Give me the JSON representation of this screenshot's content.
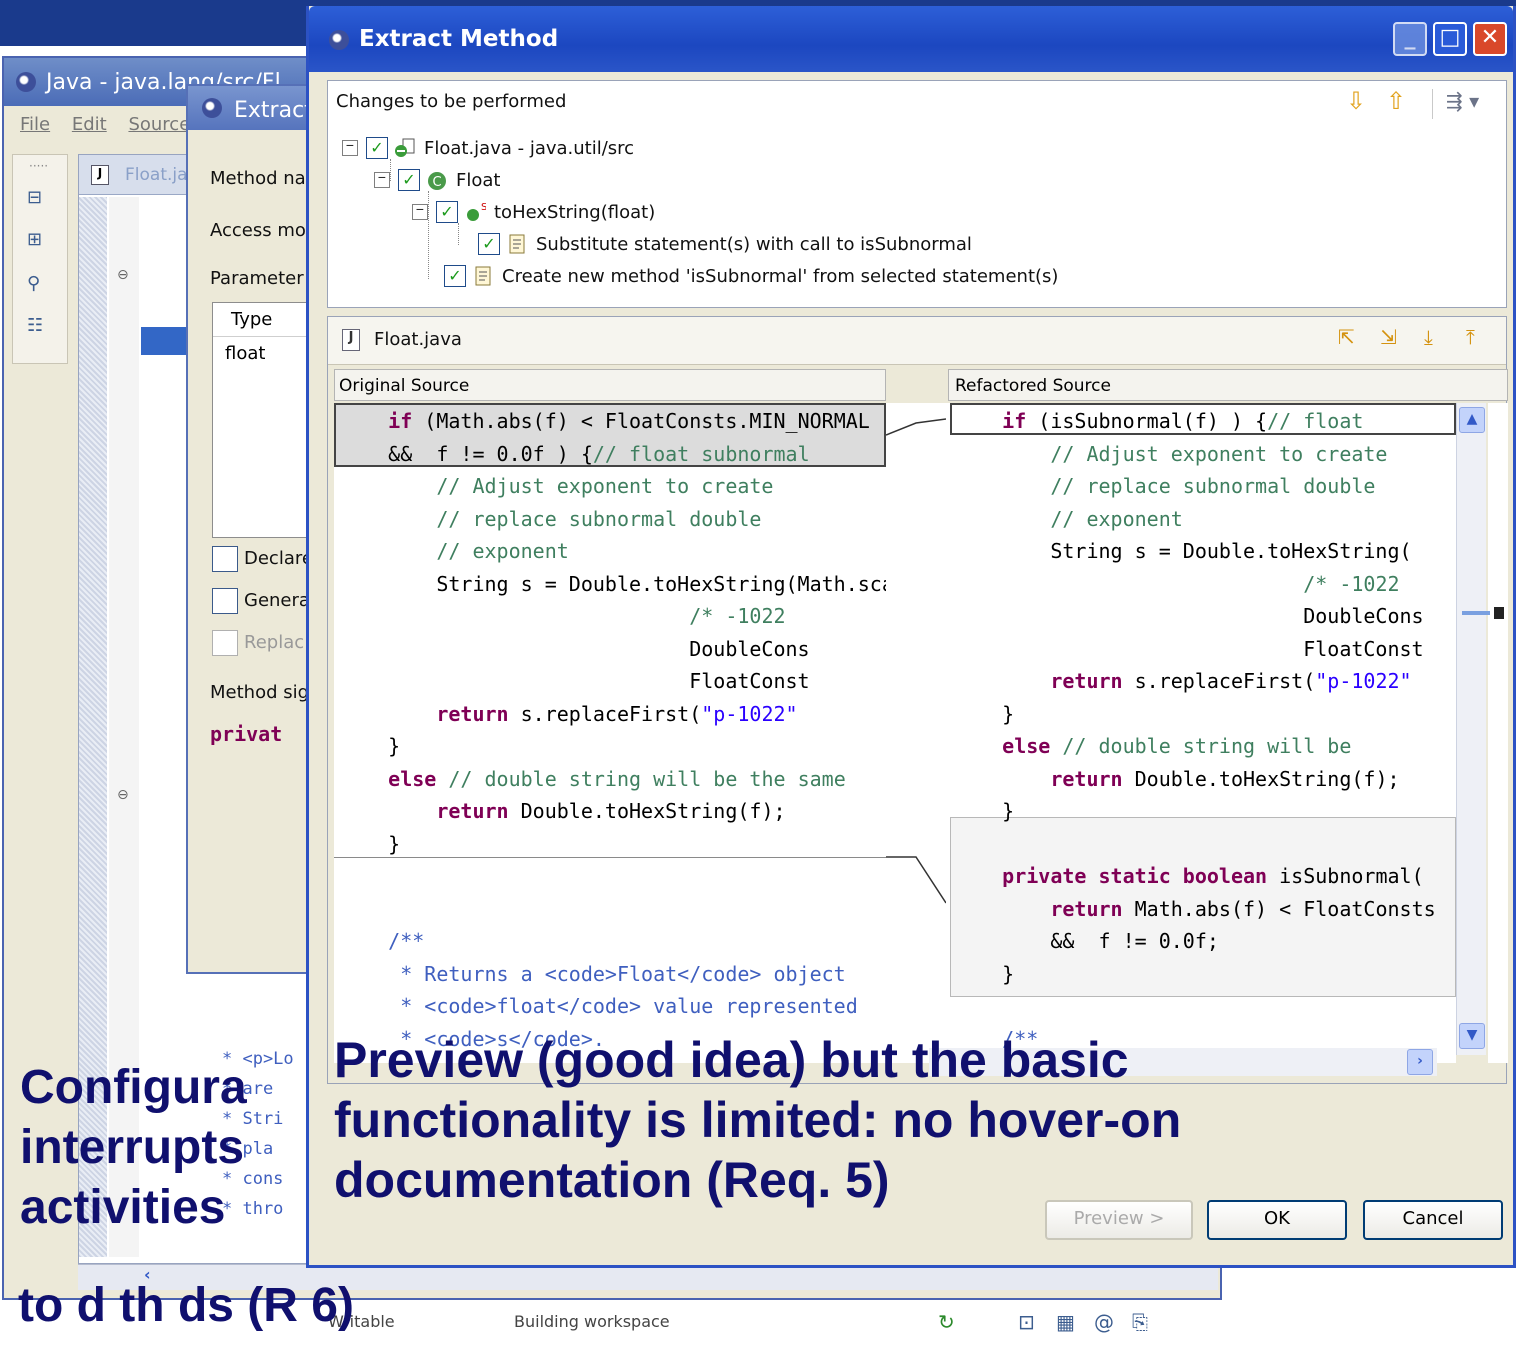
{
  "background_window": {
    "title": "Java - java.lang/src/Fl",
    "menu": [
      "File",
      "Edit",
      "Source"
    ],
    "editor_tab": "Float.ja",
    "code_lines": [
      "* <p>Lo",
      "* are",
      "* Stri",
      "* pla",
      "* cons",
      "* thro"
    ],
    "status_writable": "Writable",
    "status_building": "Building workspace"
  },
  "background_dialog": {
    "title": "Extract Method",
    "method_name_label": "Method na",
    "access_label": "Access mo",
    "parameters_label": "Parameter",
    "table_header": "Type",
    "table_row": "float",
    "declare_label": "Declare",
    "generate_label": "Genera",
    "replace_label": "Replac",
    "signature_label": "Method sig",
    "signature_value": "privat"
  },
  "dialog": {
    "title": "Extract Method",
    "changes_label": "Changes to be performed",
    "tree": [
      {
        "label": "Float.java - java.util/src",
        "checked": true
      },
      {
        "label": "Float",
        "checked": true
      },
      {
        "label": "toHexString(float)",
        "checked": true
      },
      {
        "label": "Substitute statement(s) with call to isSubnormal",
        "checked": true
      },
      {
        "label": "Create new method 'isSubnormal' from selected statement(s)",
        "checked": true
      }
    ],
    "compare_file": "Float.java",
    "original_header": "Original Source",
    "refactored_header": "Refactored Source",
    "buttons": {
      "preview": "Preview >",
      "ok": "OK",
      "cancel": "Cancel"
    }
  },
  "captions": {
    "main_line1": "Preview (good idea) but the basic",
    "main_line2": "functionality is limited: no hover-on",
    "main_line3": "documentation (Req. 5)",
    "left_line1": "Configura",
    "left_line2": "interrupts",
    "left_line3": "activities",
    "bottom_line": "to d   th    ds (R   6)"
  },
  "colors": {
    "caption": "#10106e",
    "title_bar": "#1c47c0",
    "keyword": "#7f0055",
    "comment": "#3f7f5f"
  }
}
